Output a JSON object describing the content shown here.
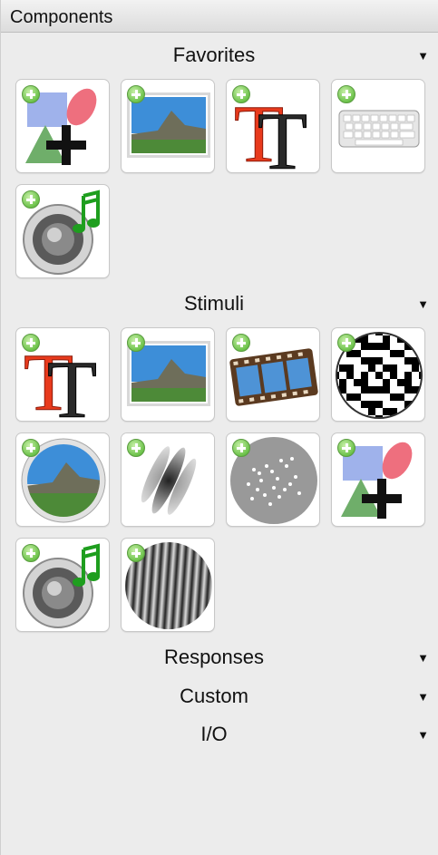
{
  "panel": {
    "title": "Components"
  },
  "sections": [
    {
      "id": "favorites",
      "title": "Favorites",
      "arrow": "▼",
      "items": [
        "polygon-component",
        "image-component",
        "text-component",
        "keyboard-component",
        "sound-component"
      ]
    },
    {
      "id": "stimuli",
      "title": "Stimuli",
      "arrow": "▼",
      "items": [
        "text-component",
        "image-component",
        "movie-component",
        "noise-component",
        "aperture-component",
        "grating-gabor-component",
        "dots-component",
        "polygon-component",
        "sound-component",
        "grating-component"
      ]
    },
    {
      "id": "responses",
      "title": "Responses",
      "arrow": "▼",
      "items": []
    },
    {
      "id": "custom",
      "title": "Custom",
      "arrow": "▼",
      "items": []
    },
    {
      "id": "io",
      "title": "I/O",
      "arrow": "▼",
      "items": []
    }
  ]
}
